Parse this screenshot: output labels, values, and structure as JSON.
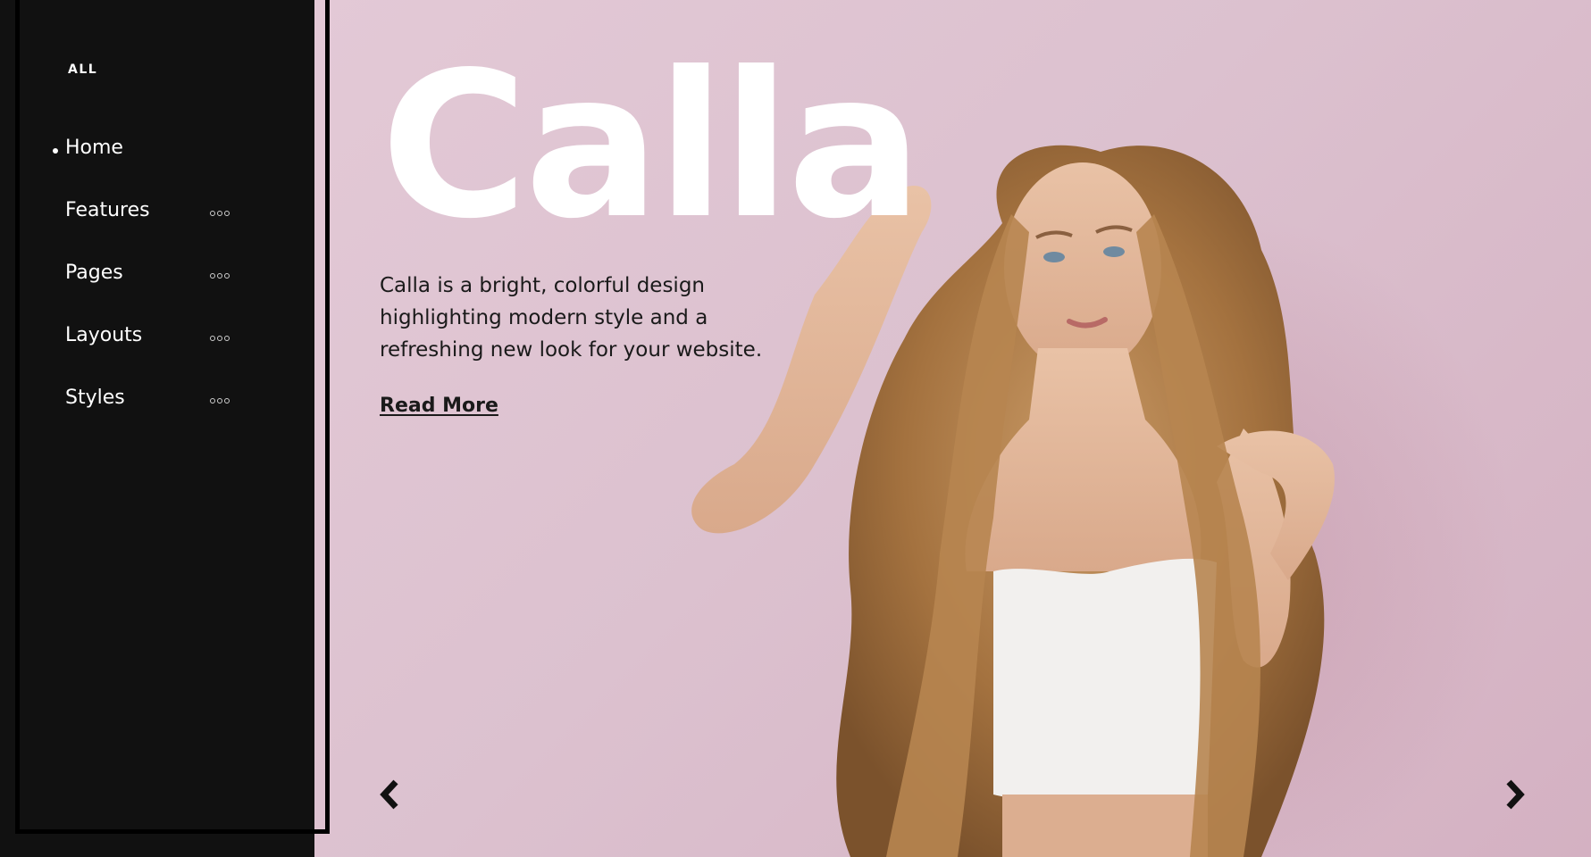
{
  "sidebar": {
    "filter_label": "ALL",
    "items": [
      {
        "label": "Home",
        "active": true,
        "has_submenu": false
      },
      {
        "label": "Features",
        "active": false,
        "has_submenu": true
      },
      {
        "label": "Pages",
        "active": false,
        "has_submenu": true
      },
      {
        "label": "Layouts",
        "active": false,
        "has_submenu": true
      },
      {
        "label": "Styles",
        "active": false,
        "has_submenu": true
      }
    ],
    "submenu_icon": "more-dots-icon",
    "background_color": "#111111"
  },
  "hero": {
    "title": "Calla",
    "description": "Calla is a bright, colorful design highlighting modern style and a refreshing new look for your website.",
    "cta_label": "Read More",
    "prev_icon": "chevron-left-icon",
    "next_icon": "chevron-right-icon",
    "background_color": "#dcc1cf",
    "title_color": "#ffffff",
    "text_color": "#1a1a1a"
  }
}
